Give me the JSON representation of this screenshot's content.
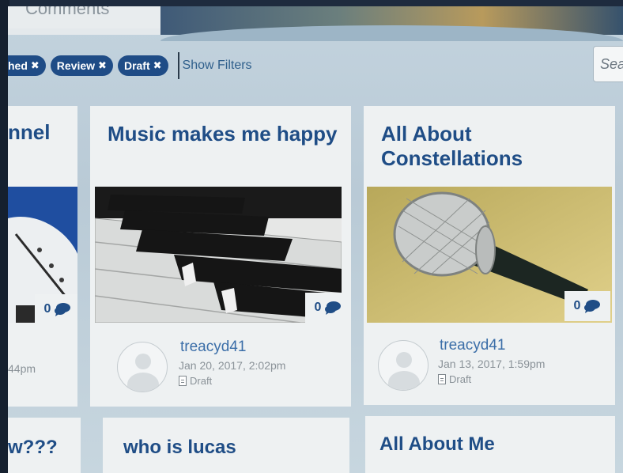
{
  "header": {
    "comments_tab": "Comments"
  },
  "filters": {
    "chips": [
      {
        "label": "hed"
      },
      {
        "label": "Review"
      },
      {
        "label": "Draft"
      }
    ],
    "remove_glyph": "✖",
    "show_filters": "Show Filters",
    "search_placeholder": "Sea"
  },
  "cards": [
    {
      "title": "nnel",
      "comment_count": "0",
      "date_partial": "44pm"
    },
    {
      "title": "Music makes me happy",
      "image_subject": "piano keys",
      "comment_count": "0",
      "author": "treacyd41",
      "date": "Jan 20, 2017, 2:02pm",
      "status": "Draft"
    },
    {
      "title": "All About Constellations",
      "image_subject": "microphone",
      "comment_count": "0",
      "author": "treacyd41",
      "date": "Jan 13, 2017, 1:59pm",
      "status": "Draft"
    }
  ],
  "bottom_cards": [
    {
      "title": "w???"
    },
    {
      "title": "who is lucas"
    },
    {
      "title": "All About Me"
    }
  ],
  "icons": {
    "comment": "comment-bubble-icon",
    "remove": "close-icon",
    "document": "document-icon",
    "avatar": "user-avatar-icon"
  },
  "colors": {
    "accent": "#1f4d86",
    "author": "#3b6ea8",
    "chip_bg": "#1f4c86"
  }
}
